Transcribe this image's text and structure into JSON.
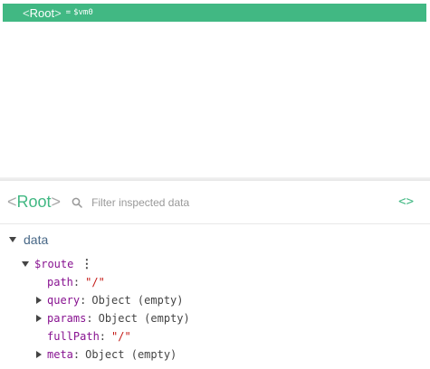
{
  "tree": {
    "root": {
      "open_bracket": "<",
      "name": "Root",
      "close_bracket": ">",
      "eq": "=",
      "ref": "$vm0"
    }
  },
  "inspector": {
    "component": {
      "open_bracket": "<",
      "name": "Root",
      "close_bracket": ">"
    },
    "search_placeholder": "Filter inspected data",
    "code_toggle": "<>"
  },
  "data": {
    "section_label": "data",
    "route": {
      "key": "$route",
      "menu": "⋮",
      "props": [
        {
          "key": "path",
          "value": "\"/\"",
          "kind": "string",
          "expandable": false
        },
        {
          "key": "query",
          "value": "Object (empty)",
          "kind": "object",
          "expandable": true
        },
        {
          "key": "params",
          "value": "Object (empty)",
          "kind": "object",
          "expandable": true
        },
        {
          "key": "fullPath",
          "value": "\"/\"",
          "kind": "string",
          "expandable": false
        },
        {
          "key": "meta",
          "value": "Object (empty)",
          "kind": "object",
          "expandable": true
        }
      ]
    }
  },
  "colors": {
    "accent": "#41b883",
    "key": "#881391",
    "string": "#c41a16"
  }
}
